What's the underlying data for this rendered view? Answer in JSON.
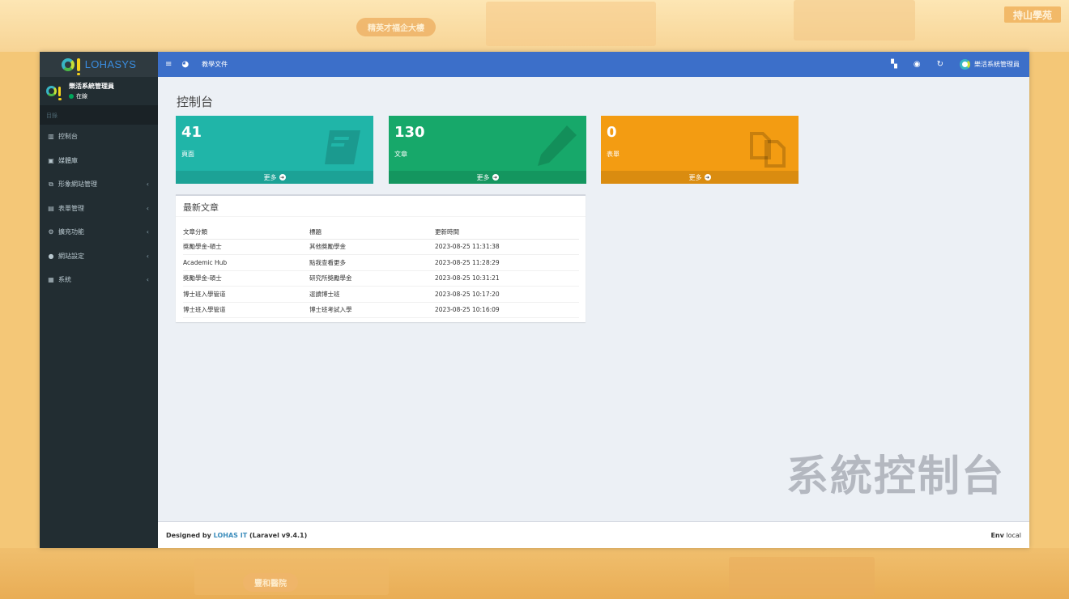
{
  "background": {
    "corner_badge": "持山學苑",
    "top_pill": "精英才福企大樓",
    "bottom_pill": "豐和醫院"
  },
  "brand": {
    "name": "LOHASYS"
  },
  "user": {
    "name": "樂活系統管理員",
    "status": "在線"
  },
  "sidebar": {
    "header": "目錄",
    "items": [
      {
        "label": "控制台",
        "icon": "bar-chart-icon",
        "has_children": false
      },
      {
        "label": "媒體庫",
        "icon": "image-icon",
        "has_children": false
      },
      {
        "label": "形象網站管理",
        "icon": "copy-icon",
        "has_children": true
      },
      {
        "label": "表單管理",
        "icon": "list-alt-icon",
        "has_children": true
      },
      {
        "label": "擴充功能",
        "icon": "cogs-icon",
        "has_children": true
      },
      {
        "label": "網站設定",
        "icon": "globe-icon",
        "has_children": true
      },
      {
        "label": "系統",
        "icon": "server-icon",
        "has_children": true
      }
    ]
  },
  "topbar": {
    "doc_link": "教學文件",
    "user_name": "樂活系統管理員"
  },
  "page": {
    "title": "控制台"
  },
  "stat_boxes": [
    {
      "count": "41",
      "label": "頁面",
      "more": "更多",
      "color": "#20b5a8",
      "icon": "book-icon"
    },
    {
      "count": "130",
      "label": "文章",
      "more": "更多",
      "color": "#17a86a",
      "icon": "pencil-icon"
    },
    {
      "count": "0",
      "label": "表單",
      "more": "更多",
      "color": "#f39c12",
      "icon": "files-icon"
    }
  ],
  "latest_articles": {
    "title": "最新文章",
    "columns": [
      "文章分類",
      "標題",
      "更新時間"
    ],
    "rows": [
      [
        "獎勵學金-碩士",
        "其他獎勵學金",
        "2023-08-25 11:31:38"
      ],
      [
        "Academic Hub",
        "點我查看更多",
        "2023-08-25 11:28:29"
      ],
      [
        "獎勵學金-碩士",
        "研究所獎勵學金",
        "2023-08-25 10:31:21"
      ],
      [
        "博士班入學管道",
        "逕讀博士班",
        "2023-08-25 10:17:20"
      ],
      [
        "博士班入學管道",
        "博士班考試入學",
        "2023-08-25 10:16:09"
      ]
    ]
  },
  "watermark": "系統控制台",
  "footer": {
    "prefix": "Designed by",
    "company": "LOHAS IT",
    "version": "(Laravel v9.4.1)",
    "env_label": "Env",
    "env_value": "local"
  }
}
